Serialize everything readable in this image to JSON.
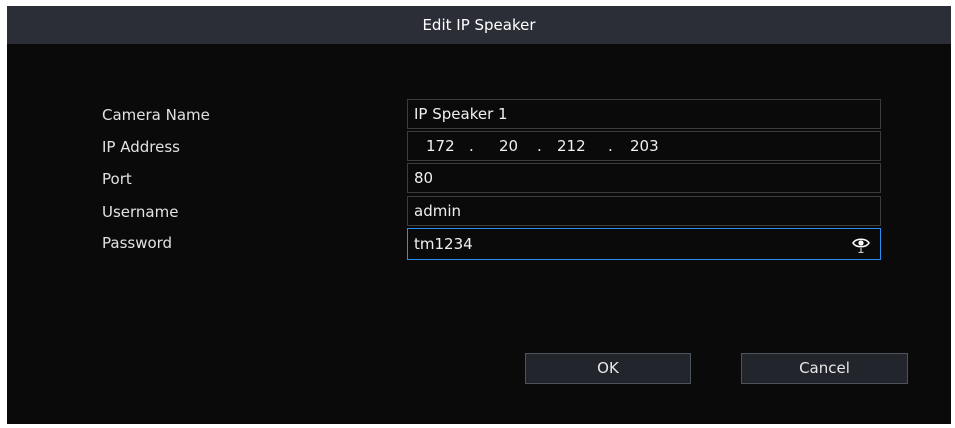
{
  "dialog": {
    "title": "Edit IP Speaker"
  },
  "form": {
    "camera_name": {
      "label": "Camera Name",
      "value": "IP Speaker 1"
    },
    "ip_address": {
      "label": "IP Address",
      "octets": [
        "172",
        "20",
        "212",
        "203"
      ],
      "separator": "."
    },
    "port": {
      "label": "Port",
      "value": "80"
    },
    "username": {
      "label": "Username",
      "value": "admin"
    },
    "password": {
      "label": "Password",
      "value": "tm1234",
      "toggle_icon": "eye-icon"
    }
  },
  "buttons": {
    "ok": "OK",
    "cancel": "Cancel"
  },
  "colors": {
    "focus_border": "#2d8cf0",
    "title_bar": "#2b2e36",
    "background": "#0a0a0a"
  }
}
